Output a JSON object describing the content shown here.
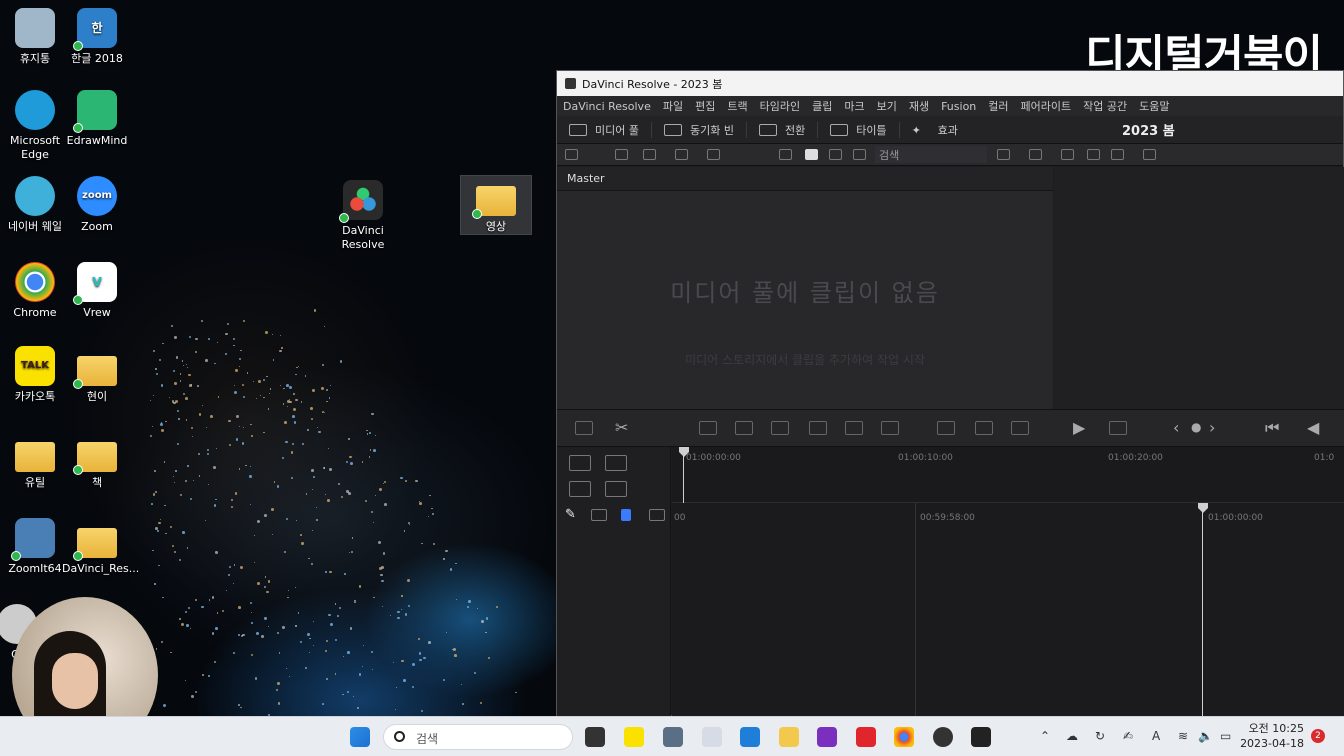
{
  "brand": "디지털거북이",
  "desktop": {
    "icons": [
      {
        "label": "휴지통",
        "icon": "recycle-bin-icon",
        "color": "#9fb7c9"
      },
      {
        "label": "한글 2018",
        "icon": "hangul-icon",
        "color": "#2e7fc9"
      },
      {
        "label": "Microsoft\nEdge",
        "icon": "edge-icon",
        "color": "#1f9bd9"
      },
      {
        "label": "EdrawMind",
        "icon": "edrawmind-icon",
        "color": "#2bb673"
      },
      {
        "label": "네이버 웨일",
        "icon": "whale-icon",
        "color": "#3fb0d9"
      },
      {
        "label": "Zoom",
        "icon": "zoom-icon",
        "color": "#2d8cff"
      },
      {
        "label": "Chrome",
        "icon": "chrome-icon",
        "color": "#e8453c"
      },
      {
        "label": "Vrew",
        "icon": "vrew-icon",
        "color": "#ffffff"
      },
      {
        "label": "카카오톡",
        "icon": "kakaotalk-icon",
        "color": "#fae100"
      },
      {
        "label": "현이",
        "icon": "folder-icon",
        "color": "#f2c94c"
      },
      {
        "label": "유틸",
        "icon": "folder-icon",
        "color": "#f2c94c"
      },
      {
        "label": "책",
        "icon": "folder-icon",
        "color": "#f2c94c"
      },
      {
        "label": "ZoomIt64",
        "icon": "zoomit-icon",
        "color": "#4a7fb5"
      },
      {
        "label": "DaVinci_Res...",
        "icon": "folder-icon",
        "color": "#f2c94c"
      },
      {
        "label": "DaVinci\nResolve",
        "icon": "davinci-icon",
        "color": "#2a2a2a"
      },
      {
        "label": "영상",
        "icon": "folder-icon",
        "color": "#f2c94c"
      },
      {
        "label": "Ol",
        "icon": "clock-icon",
        "color": "#cccccc"
      }
    ]
  },
  "window": {
    "title": "DaVinci Resolve - 2023 봄",
    "menu": [
      "DaVinci Resolve",
      "파일",
      "편집",
      "트랙",
      "타임라인",
      "클립",
      "마크",
      "보기",
      "재생",
      "Fusion",
      "컬러",
      "페어라이트",
      "작업 공간",
      "도움말"
    ],
    "pages": [
      "미디어 풀",
      "동기화 빈",
      "전환",
      "타이틀",
      "효과"
    ],
    "project_name": "2023 봄",
    "search_label": "검색",
    "pool_header": "Master",
    "pool_empty": "미디어 풀에 클립이 없음",
    "pool_hint": "미디어 스토리지에서 클립을 추가하여 작업 시작",
    "ruler_ticks": [
      "01:00:00:00",
      "01:00:10:00",
      "01:00:20:00",
      "01:0"
    ],
    "lower_ticks": [
      "00",
      "00:59:58:00",
      "01:00:00:00"
    ]
  },
  "taskbar": {
    "search": "검색",
    "time": "오전 10:25",
    "date": "2023-04-18",
    "notifications": "2"
  }
}
